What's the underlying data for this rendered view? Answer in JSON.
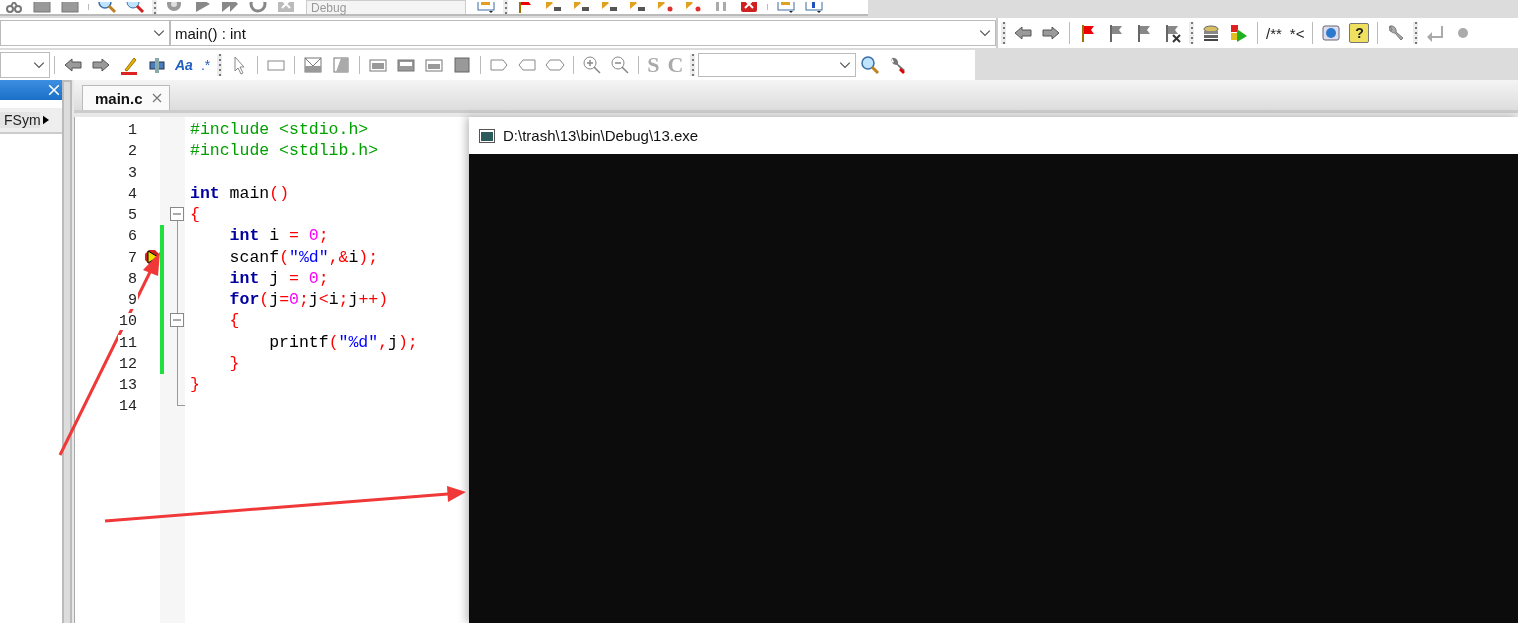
{
  "toolbar_row1": {
    "build_target": "Debug"
  },
  "toolbar_row2": {
    "function_combo": "main() : int",
    "doxygen_buttons": [
      "/**",
      "*<"
    ],
    "help_button": "?"
  },
  "toolbar_row3": {
    "text_buttons": [
      "Aa",
      ".*"
    ],
    "style_buttons": [
      "S",
      "C"
    ]
  },
  "side_panel": {
    "tab": "FSym"
  },
  "editor": {
    "tabs": [
      {
        "label": "main.c",
        "selected": true
      }
    ],
    "lines": [
      {
        "number": "1",
        "tokens": [
          {
            "kind": "preprocessor",
            "text": "#include <stdio.h>"
          }
        ]
      },
      {
        "number": "2",
        "tokens": [
          {
            "kind": "preprocessor",
            "text": "#include <stdlib.h>"
          }
        ]
      },
      {
        "number": "3"
      },
      {
        "number": "4",
        "tokens": [
          {
            "kind": "keyword",
            "text": "int"
          },
          {
            "kind": "plain",
            "text": " main"
          },
          {
            "kind": "operator",
            "text": "()"
          }
        ]
      },
      {
        "number": "5",
        "fold": {
          "expanded": true
        },
        "tokens": [
          {
            "kind": "operator",
            "text": "{"
          }
        ]
      },
      {
        "number": "6",
        "changed": true,
        "tokens": [
          {
            "kind": "keyword",
            "text": "    int"
          },
          {
            "kind": "plain",
            "text": " i "
          },
          {
            "kind": "operator",
            "text": "="
          },
          {
            "kind": "number",
            "text": " 0"
          },
          {
            "kind": "operator",
            "text": ";"
          }
        ]
      },
      {
        "number": "7",
        "changed": true,
        "breakpoint": true,
        "current": true,
        "tokens": [
          {
            "kind": "plain",
            "text": "    scanf"
          },
          {
            "kind": "operator",
            "text": "("
          },
          {
            "kind": "string",
            "text": "\"%d\""
          },
          {
            "kind": "operator",
            "text": ",&"
          },
          {
            "kind": "plain",
            "text": "i"
          },
          {
            "kind": "operator",
            "text": ");"
          }
        ]
      },
      {
        "number": "8",
        "changed": true,
        "tokens": [
          {
            "kind": "keyword",
            "text": "    int"
          },
          {
            "kind": "plain",
            "text": " j "
          },
          {
            "kind": "operator",
            "text": "="
          },
          {
            "kind": "number",
            "text": " 0"
          },
          {
            "kind": "operator",
            "text": ";"
          }
        ]
      },
      {
        "number": "9",
        "changed": true,
        "tokens": [
          {
            "kind": "keyword",
            "text": "    for"
          },
          {
            "kind": "operator",
            "text": "("
          },
          {
            "kind": "plain",
            "text": "j"
          },
          {
            "kind": "operator",
            "text": "="
          },
          {
            "kind": "number",
            "text": "0"
          },
          {
            "kind": "operator",
            "text": ";"
          },
          {
            "kind": "plain",
            "text": "j"
          },
          {
            "kind": "operator",
            "text": "<"
          },
          {
            "kind": "plain",
            "text": "i"
          },
          {
            "kind": "operator",
            "text": ";"
          },
          {
            "kind": "plain",
            "text": "j"
          },
          {
            "kind": "operator",
            "text": "++)"
          }
        ]
      },
      {
        "number": "10",
        "changed": true,
        "fold": {
          "expanded": true
        },
        "tokens": [
          {
            "kind": "operator",
            "text": "    {"
          }
        ]
      },
      {
        "number": "11",
        "changed": true,
        "tokens": [
          {
            "kind": "plain",
            "text": "        printf"
          },
          {
            "kind": "operator",
            "text": "("
          },
          {
            "kind": "string",
            "text": "\"%d\""
          },
          {
            "kind": "operator",
            "text": ","
          },
          {
            "kind": "plain",
            "text": "j"
          },
          {
            "kind": "operator",
            "text": ");"
          }
        ]
      },
      {
        "number": "12",
        "changed": true,
        "tokens": [
          {
            "kind": "operator",
            "text": "    }"
          }
        ]
      },
      {
        "number": "13",
        "tokens": [
          {
            "kind": "operator",
            "text": "}"
          }
        ]
      },
      {
        "number": "14"
      }
    ]
  },
  "console_window": {
    "title": "D:\\trash\\13\\bin\\Debug\\13.exe"
  }
}
